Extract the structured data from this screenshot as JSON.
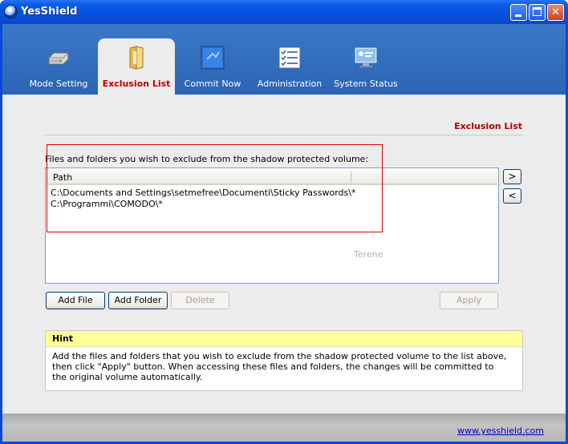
{
  "window": {
    "title": "YesShield"
  },
  "tabs": [
    {
      "label": "Mode Setting",
      "icon": "drive-icon"
    },
    {
      "label": "Exclusion List",
      "icon": "folder-icon",
      "active": true
    },
    {
      "label": "Commit Now",
      "icon": "commit-icon"
    },
    {
      "label": "Administration",
      "icon": "checklist-icon"
    },
    {
      "label": "System Status",
      "icon": "monitor-icon"
    }
  ],
  "exclusion": {
    "section_title": "Exclusion List",
    "description": "Files and folders you wish to exclude from the shadow protected volume:",
    "column_path": "Path",
    "rows": [
      "C:\\Documents and Settings\\setmefree\\Documenti\\Sticky Passwords\\*",
      "C:\\Programmi\\COMODO\\*"
    ],
    "watermark": "Terene",
    "move_right": ">",
    "move_left": "<",
    "add_file": "Add File",
    "add_folder": "Add Folder",
    "delete": "Delete",
    "apply": "Apply"
  },
  "hint": {
    "title": "Hint",
    "text": "Add the files and folders that you wish to exclude from the shadow protected volume to the list above, then click \"Apply\" button. When accessing these files and folders, the changes will be committed to the original volume automatically."
  },
  "footer": {
    "link": "www.yesshield.com"
  },
  "colors": {
    "titlebar": "#0550dc",
    "tabstrip": "#2c64b4",
    "active_tab_label": "#c00000",
    "hint_header": "#ffff99",
    "highlight_box": "#e00000"
  }
}
